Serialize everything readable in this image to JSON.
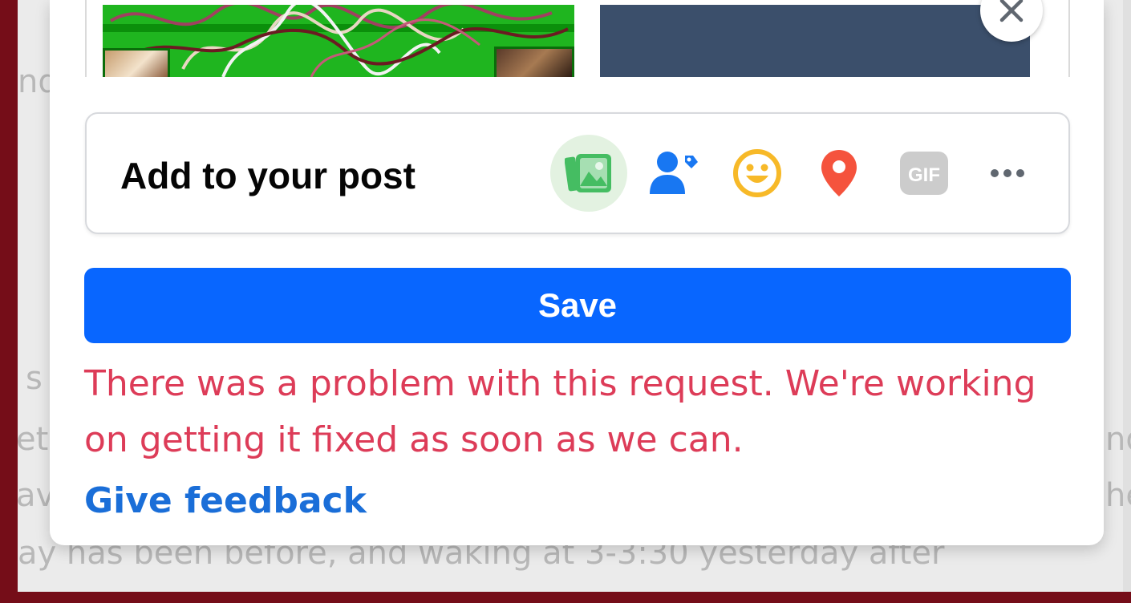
{
  "background_page": {
    "fragments": [
      "nd",
      "s",
      "et",
      "av",
      "nd",
      "he"
    ],
    "bottom_line": "ay has been before, and waking at 3-3:30 yesterday after"
  },
  "composer": {
    "add_to_post_label": "Add to your post",
    "tools": [
      {
        "icon": "photo-video-icon",
        "color": "#45bd62"
      },
      {
        "icon": "tag-people-icon",
        "color": "#1877f2"
      },
      {
        "icon": "feeling-activity-icon",
        "color": "#f7b928"
      },
      {
        "icon": "check-in-icon",
        "color": "#f5533d"
      },
      {
        "icon": "gif-icon",
        "label": "GIF",
        "color": "#cccccc"
      },
      {
        "icon": "more-options-icon",
        "color": "#606770"
      }
    ],
    "save_label": "Save",
    "error_message": "There was a problem with this request. We're working on getting it fixed as soon as we can.",
    "feedback_link": "Give feedback"
  },
  "colors": {
    "primary": "#0866ff",
    "error": "#dd3c58",
    "link": "#1a6ed8",
    "frame": "#750d18"
  }
}
